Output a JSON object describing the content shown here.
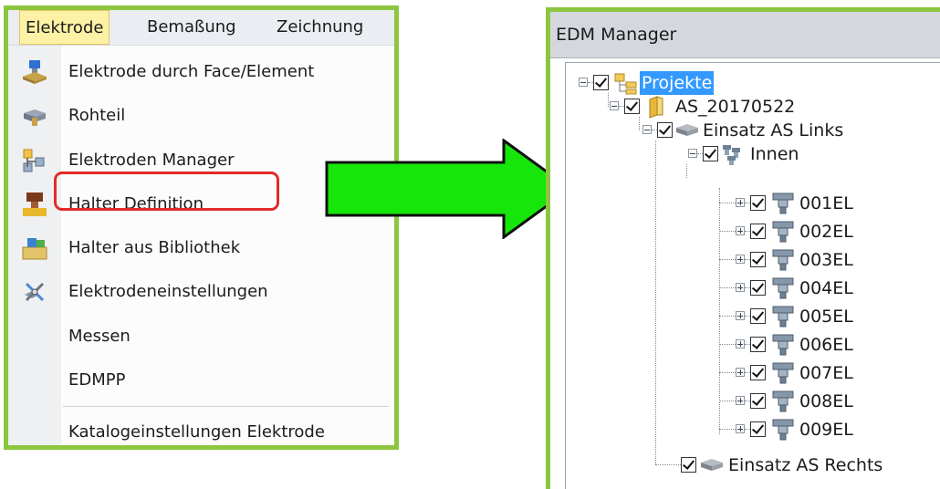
{
  "menu": {
    "bar_items": [
      {
        "label": "Elektrode",
        "active": true
      },
      {
        "label": "Bemaßung",
        "active": false
      },
      {
        "label": "Zeichnung",
        "active": false
      }
    ],
    "dropdown_items": [
      {
        "label": "Elektrode durch Face/Element",
        "icon": "electrode-face-icon"
      },
      {
        "label": "Rohteil",
        "icon": "blank-part-icon"
      },
      {
        "label": "Elektroden Manager",
        "icon": "electrode-manager-icon",
        "highlighted": true
      },
      {
        "label": "Halter Definition",
        "icon": "holder-definition-icon"
      },
      {
        "label": "Halter aus Bibliothek",
        "icon": "holder-library-icon"
      },
      {
        "label": "Elektrodeneinstellungen",
        "icon": "electrode-settings-icon"
      },
      {
        "label": "Messen",
        "icon": ""
      },
      {
        "label": "EDMPP",
        "icon": ""
      },
      {
        "label": "Katalogeinstellungen Elektrode",
        "icon": ""
      }
    ],
    "highlight_color": "#e22a2a"
  },
  "edm": {
    "title": "EDM Manager",
    "tree": {
      "root": "Projekte",
      "project": "AS_20170522",
      "insert_left": "Einsatz AS Links",
      "group": "Innen",
      "electrodes": [
        "001EL",
        "002EL",
        "003EL",
        "004EL",
        "005EL",
        "006EL",
        "007EL",
        "008EL",
        "009EL"
      ],
      "insert_right": "Einsatz AS Rechts"
    },
    "selection_color": "#3399ff"
  },
  "colors": {
    "frame_green": "#8cc63f",
    "arrow_green": "#16e60a"
  }
}
